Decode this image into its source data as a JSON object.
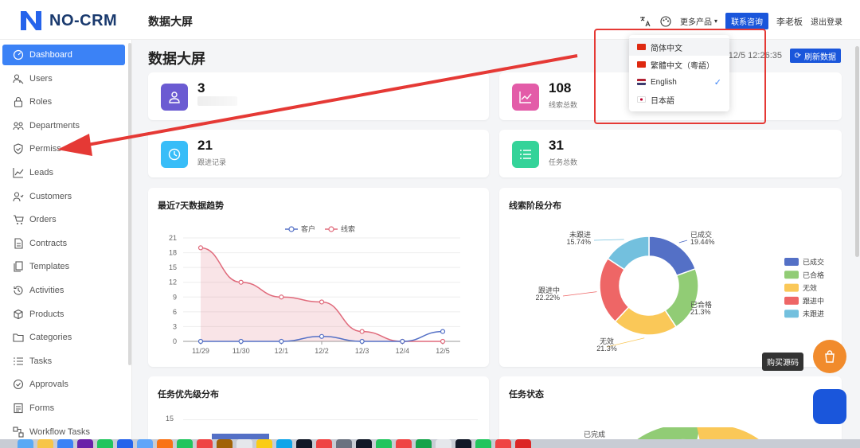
{
  "app": {
    "name": "NO-CRM",
    "top_title": "数据大屏"
  },
  "header": {
    "more_products": "更多产品",
    "contact": "联系咨询",
    "user": "李老板",
    "logout": "退出登录"
  },
  "sidebar": {
    "items": [
      {
        "label": "Dashboard",
        "icon": "dashboard-icon",
        "active": true
      },
      {
        "label": "Users",
        "icon": "users-icon"
      },
      {
        "label": "Roles",
        "icon": "lock-icon"
      },
      {
        "label": "Departments",
        "icon": "departments-icon"
      },
      {
        "label": "Permiss",
        "icon": "shield-icon"
      },
      {
        "label": "Leads",
        "icon": "chart-line-icon"
      },
      {
        "label": "Customers",
        "icon": "customers-icon"
      },
      {
        "label": "Orders",
        "icon": "cart-icon"
      },
      {
        "label": "Contracts",
        "icon": "contract-icon"
      },
      {
        "label": "Templates",
        "icon": "templates-icon"
      },
      {
        "label": "Activities",
        "icon": "history-icon"
      },
      {
        "label": "Products",
        "icon": "box-icon"
      },
      {
        "label": "Categories",
        "icon": "folder-icon"
      },
      {
        "label": "Tasks",
        "icon": "list-icon"
      },
      {
        "label": "Approvals",
        "icon": "check-circle-icon"
      },
      {
        "label": "Forms",
        "icon": "form-icon"
      },
      {
        "label": "Workflow Tasks",
        "icon": "workflow-icon"
      }
    ]
  },
  "main": {
    "page_title": "数据大屏",
    "timestamp": "12/5 12:26:35",
    "refresh": "刷新数据"
  },
  "stats": [
    {
      "value": "3",
      "label": "",
      "color": "#6b5bd2",
      "icon": "user-icon"
    },
    {
      "value": "108",
      "label": "线索总数",
      "color": "#e35ca8",
      "icon": "chart-line-icon"
    },
    {
      "value": "21",
      "label": "跟进记录",
      "color": "#38bdf8",
      "icon": "clock-icon"
    },
    {
      "value": "31",
      "label": "任务总数",
      "color": "#34d399",
      "icon": "list-icon"
    }
  ],
  "language_menu": {
    "items": [
      {
        "label": "简体中文",
        "flag": "cn",
        "highlighted": true
      },
      {
        "label": "繁體中文（粵語）",
        "flag": "hk"
      },
      {
        "label": "English",
        "flag": "us",
        "selected": true
      },
      {
        "label": "日本語",
        "flag": "jp"
      }
    ]
  },
  "panels": {
    "trend_title": "最近7天数据趋势",
    "stage_title": "线索阶段分布",
    "priority_title": "任务优先级分布",
    "status_title": "任务状态",
    "priority_tick": "15",
    "status_label": "已完成"
  },
  "floating": {
    "tooltip": "购买源码"
  },
  "chart_data": [
    {
      "type": "line",
      "title": "最近7天数据趋势",
      "categories": [
        "11/29",
        "11/30",
        "12/1",
        "12/2",
        "12/3",
        "12/4",
        "12/5"
      ],
      "yticks": [
        "0",
        "3",
        "6",
        "9",
        "12",
        "15",
        "18",
        "21"
      ],
      "ylim": [
        0,
        21
      ],
      "legend_position": "top",
      "series": [
        {
          "name": "客户",
          "color": "#5470c6",
          "values": [
            0,
            0,
            0,
            1,
            0,
            0,
            2
          ]
        },
        {
          "name": "线索",
          "color": "#e06a7b",
          "values": [
            19,
            12,
            9,
            8,
            2,
            0,
            0
          ]
        }
      ]
    },
    {
      "type": "pie",
      "title": "线索阶段分布",
      "legend_position": "right",
      "slices": [
        {
          "name": "已成交",
          "value": 19.44,
          "pct": "19.44%",
          "color": "#5470c6"
        },
        {
          "name": "已合格",
          "value": 21.3,
          "pct": "21.3%",
          "color": "#91cc75"
        },
        {
          "name": "无效",
          "value": 21.3,
          "pct": "21.3%",
          "color": "#fac858"
        },
        {
          "name": "跟进中",
          "value": 22.22,
          "pct": "22.22%",
          "color": "#ee6666"
        },
        {
          "name": "未跟进",
          "value": 15.74,
          "pct": "15.74%",
          "color": "#73c0de"
        }
      ]
    }
  ]
}
